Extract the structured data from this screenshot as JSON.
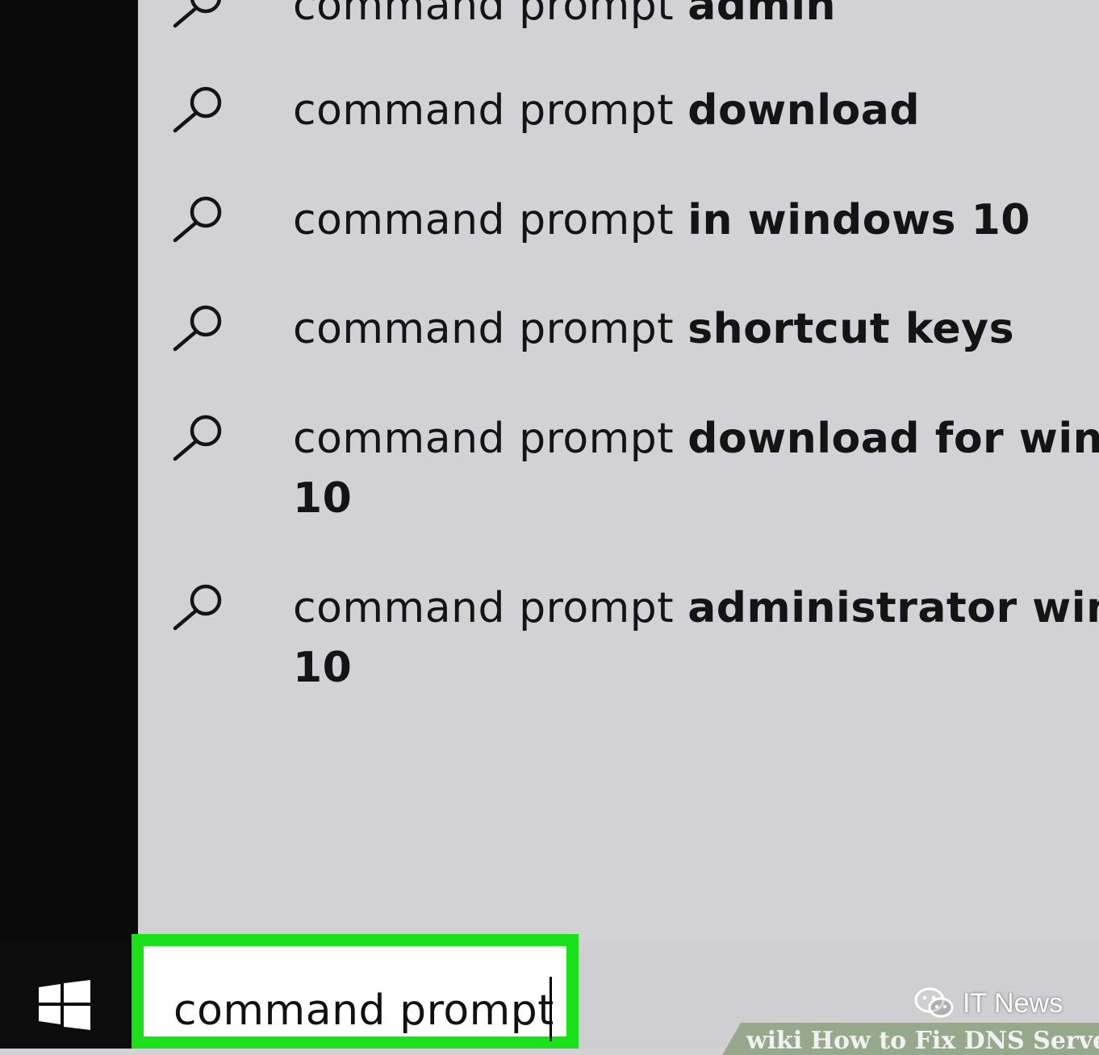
{
  "search": {
    "query": "command prompt",
    "suggestions": [
      {
        "base": "command prompt",
        "suffix": "admin"
      },
      {
        "base": "command prompt",
        "suffix": "download"
      },
      {
        "base": "command prompt",
        "suffix": "in windows 10"
      },
      {
        "base": "command prompt",
        "suffix": "shortcut keys"
      },
      {
        "base": "command prompt",
        "suffix": "download for windows",
        "wrap": "10"
      },
      {
        "base": "command prompt",
        "suffix": "administrator windows",
        "wrap": "10"
      }
    ]
  },
  "taskbar": {
    "start_icon": "windows-logo-icon"
  },
  "watermark": {
    "icon": "wechat-icon",
    "label": "IT News"
  },
  "footer_banner": {
    "text": "wiki How to Fix DNS Serve"
  },
  "colors": {
    "search_highlight": "#1be11b",
    "panel": "#d2d2d4",
    "rail": "#0a0a0a"
  }
}
